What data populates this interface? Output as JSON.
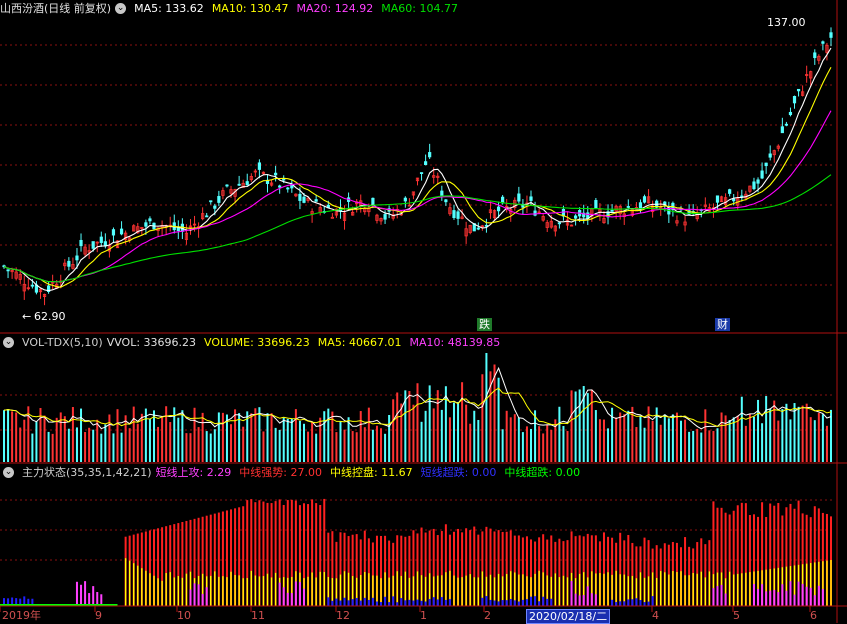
{
  "price_panel": {
    "title": "山西汾酒(日线 前复权)",
    "ma5": "MA5: 133.62",
    "ma10": "MA10: 130.47",
    "ma20": "MA20: 124.92",
    "ma60": "MA60: 104.77",
    "high_label": "137.00",
    "low_label": "62.90",
    "tag_1": "跌",
    "tag_2": "财"
  },
  "volume_panel": {
    "indicator": "VOL-TDX(5,10)",
    "vvol": "VVOL: 33696.23",
    "volume": "VOLUME: 33696.23",
    "ma5": "MA5: 40667.01",
    "ma10": "MA10: 48139.85"
  },
  "main_force_panel": {
    "indicator": "主力状态(35,35,1,42,21)",
    "short_attack": "短线上攻: 2.29",
    "mid_strong": "中线强势: 27.00",
    "mid_control": "中线控盘: 11.67",
    "short_plunge": "短线超跌: 0.00",
    "mid_plunge": "中线超跌: 0.00"
  },
  "time_axis": {
    "labels": [
      "2019年",
      "9",
      "10",
      "11",
      "12",
      "1",
      "2",
      "2020/02/18/二",
      "4",
      "5",
      "6"
    ]
  },
  "colors": {
    "up": "#ff3333",
    "down": "#54ffff",
    "ma5": "#ffffff",
    "ma10": "#ffff00",
    "ma20": "#ff00ff",
    "ma60": "#00e000",
    "mid_strong": "#ff2020",
    "mid_control": "#ffff00",
    "short_attack": "#ff40ff",
    "short_plunge": "#2020ff",
    "mid_plunge": "#00ff00",
    "grid": "#8a1010"
  },
  "chart_data": [
    {
      "type": "candlestick",
      "title": "山西汾酒(日线 前复权)",
      "x_range": [
        "2019-08",
        "2020-06"
      ],
      "y_range": [
        62.9,
        137.0
      ],
      "annotations": [
        {
          "label": "137.00",
          "meaning": "high"
        },
        {
          "label": "62.90",
          "meaning": "low"
        }
      ],
      "series": [
        {
          "name": "MA5",
          "last": 133.62
        },
        {
          "name": "MA10",
          "last": 130.47
        },
        {
          "name": "MA20",
          "last": 124.92
        },
        {
          "name": "MA60",
          "last": 104.77
        }
      ]
    },
    {
      "type": "bar",
      "title": "VOL-TDX(5,10)",
      "series": [
        {
          "name": "VVOL",
          "last": 33696.23
        },
        {
          "name": "VOLUME",
          "last": 33696.23
        },
        {
          "name": "MA5",
          "last": 40667.01
        },
        {
          "name": "MA10",
          "last": 48139.85
        }
      ]
    },
    {
      "type": "bar",
      "title": "主力状态(35,35,1,42,21)",
      "series": [
        {
          "name": "短线上攻",
          "last": 2.29
        },
        {
          "name": "中线强势",
          "last": 27.0
        },
        {
          "name": "中线控盘",
          "last": 11.67
        },
        {
          "name": "短线超跌",
          "last": 0.0
        },
        {
          "name": "中线超跌",
          "last": 0.0
        }
      ]
    }
  ]
}
